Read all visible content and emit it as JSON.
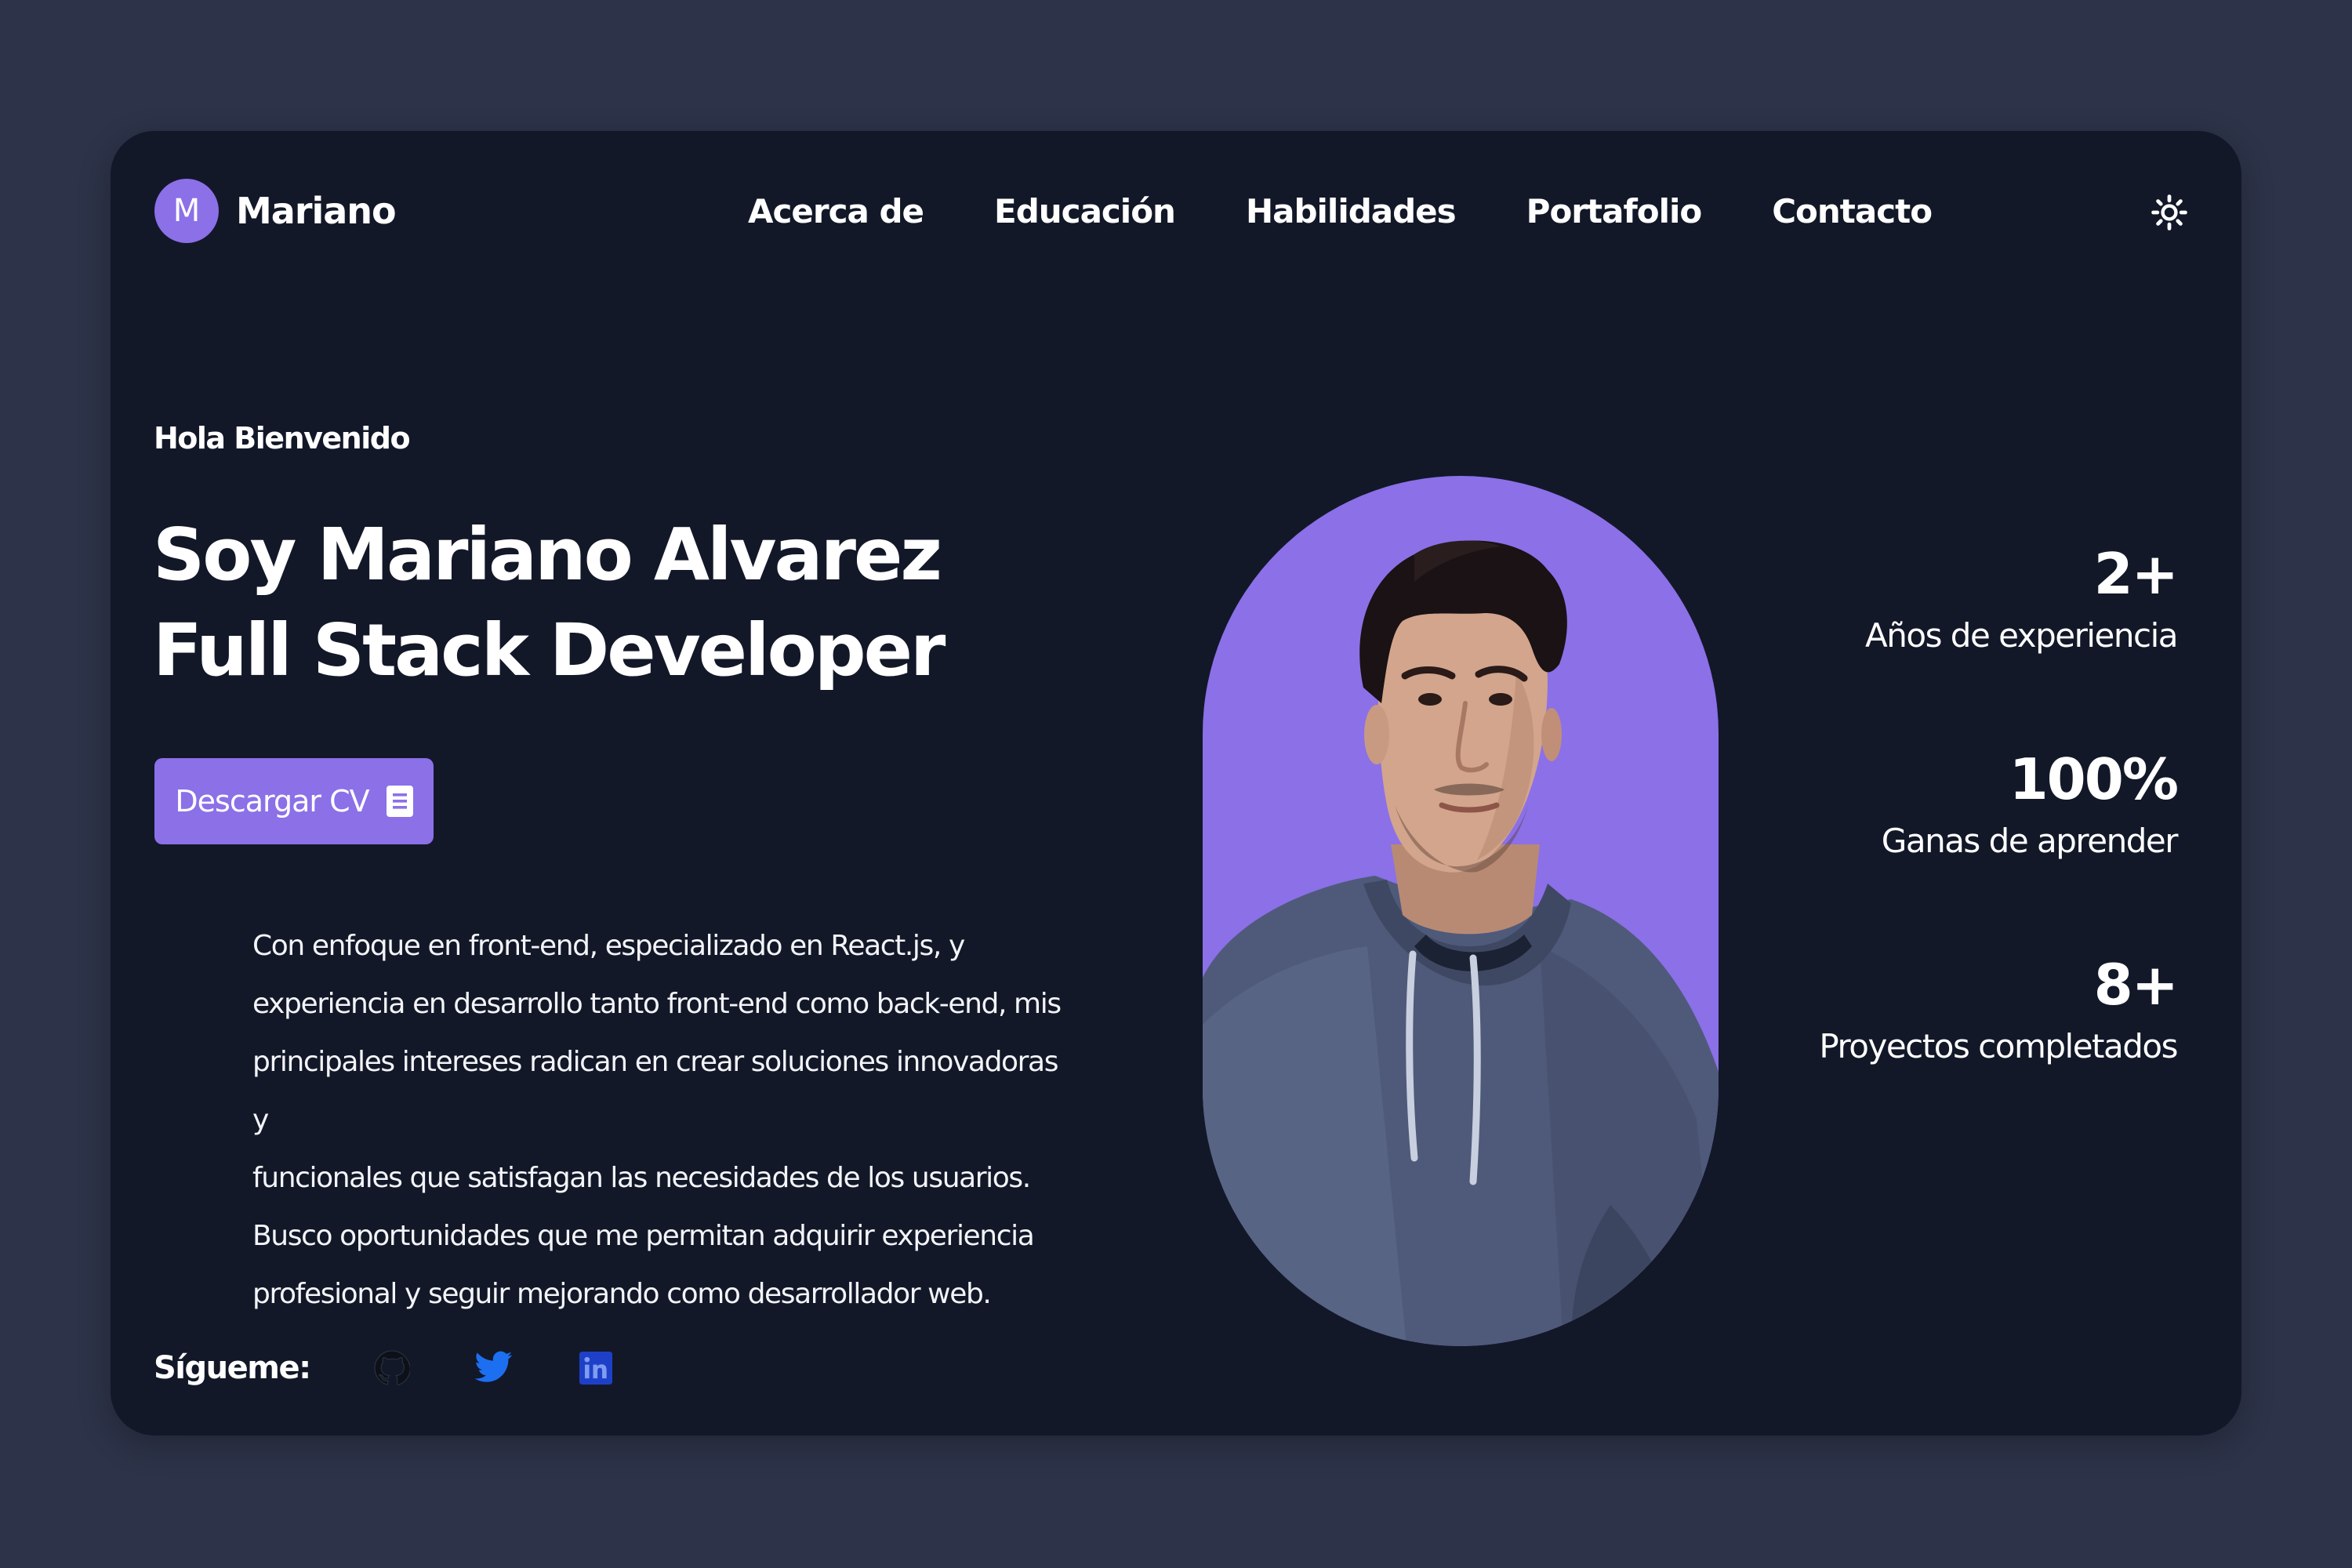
{
  "brand": {
    "initial": "M",
    "name": "Mariano"
  },
  "nav": {
    "items": [
      "Acerca de",
      "Educación",
      "Habilidades",
      "Portafolio",
      "Contacto"
    ]
  },
  "theme_toggle": {
    "icon": "sun-icon"
  },
  "hero": {
    "greeting": "Hola Bienvenido",
    "title_line1": "Soy Mariano Alvarez",
    "title_line2": "Full Stack Developer",
    "cv_button": {
      "label": "Descargar CV",
      "icon": "document-icon"
    },
    "description_lines": [
      "Con enfoque en front-end, especializado en React.js, y",
      "experiencia en desarrollo tanto front-end como back-end, mis",
      "principales intereses radican en crear soluciones innovadoras y",
      "funcionales que satisfagan las necesidades de los usuarios.",
      "Busco oportunidades que me permitan adquirir experiencia",
      "profesional y seguir mejorando como desarrollador web."
    ]
  },
  "follow": {
    "label": "Sígueme:",
    "links": [
      {
        "icon": "github-icon",
        "color": "#0d1117"
      },
      {
        "icon": "twitter-icon",
        "color": "#1d6ff2"
      },
      {
        "icon": "linkedin-icon",
        "color": "#1e40c8"
      }
    ]
  },
  "stats": [
    {
      "value": "2+",
      "label": "Años de experiencia"
    },
    {
      "value": "100%",
      "label": "Ganas de aprender"
    },
    {
      "value": "8+",
      "label": "Proyectos completados"
    }
  ],
  "colors": {
    "page_background": "#2d3348",
    "card_background": "#121828",
    "accent": "#8b70e8",
    "text": "#ffffff"
  }
}
